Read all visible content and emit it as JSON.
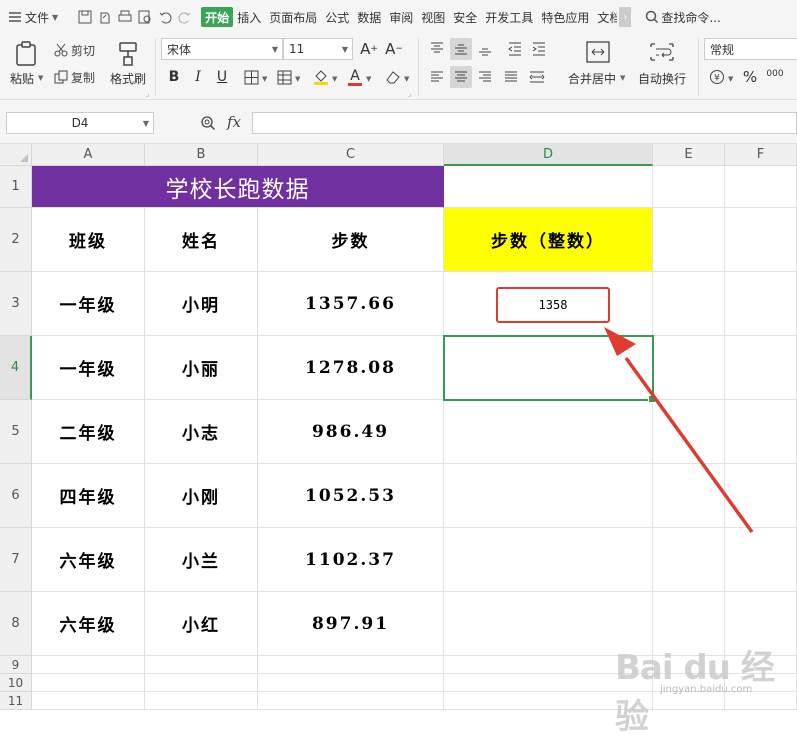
{
  "menubar": {
    "file_label": "文件",
    "tabs": [
      "开始",
      "插入",
      "页面布局",
      "公式",
      "数据",
      "审阅",
      "视图",
      "安全",
      "开发工具",
      "特色应用",
      "文档"
    ],
    "active_tab": "开始",
    "search_label": "查找命令..."
  },
  "ribbon": {
    "paste_label": "粘贴",
    "cut_label": "剪切",
    "copy_label": "复制",
    "format_painter_label": "格式刷",
    "font_name": "宋体",
    "font_size": "11",
    "merge_center_label": "合并居中",
    "wrap_text_label": "自动换行",
    "number_format": "常规",
    "percent_symbol": "%",
    "thousands_symbol": "000",
    "font_color": "#e03b2f",
    "fill_color": "#ffd700",
    "accent_color": "#3ba557"
  },
  "formula_bar": {
    "name_box": "D4",
    "fx_label": "fx",
    "formula": ""
  },
  "sheet": {
    "columns": [
      "A",
      "B",
      "C",
      "D",
      "E",
      "F"
    ],
    "rows": [
      "1",
      "2",
      "3",
      "4",
      "5",
      "6",
      "7",
      "8",
      "9",
      "10",
      "11"
    ],
    "selected_cell": "D4",
    "title": "学校长跑数据",
    "headers": [
      "班级",
      "姓名",
      "步数",
      "步数（整数）"
    ],
    "data_rows": [
      {
        "class": "一年级",
        "name": "小明",
        "steps": "1357.66",
        "steps_int": "1358"
      },
      {
        "class": "一年级",
        "name": "小丽",
        "steps": "1278.08",
        "steps_int": ""
      },
      {
        "class": "二年级",
        "name": "小志",
        "steps": "986.49",
        "steps_int": ""
      },
      {
        "class": "四年级",
        "name": "小刚",
        "steps": "1052.53",
        "steps_int": ""
      },
      {
        "class": "六年级",
        "name": "小兰",
        "steps": "1102.37",
        "steps_int": ""
      },
      {
        "class": "六年级",
        "name": "小红",
        "steps": "897.91",
        "steps_int": ""
      }
    ],
    "title_color": "#7030a0",
    "header_highlight_color": "#ffff00",
    "annotation_color": "#e03b2f",
    "selection_color": "#3c9a4c"
  },
  "watermark": {
    "brand": "Bai du 经验",
    "url": "jingyan.baidu.com"
  }
}
